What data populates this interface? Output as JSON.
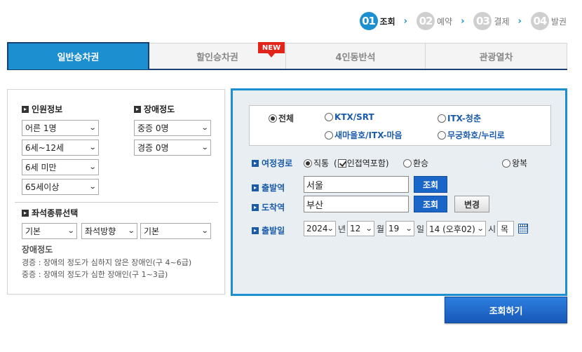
{
  "steps": [
    {
      "num": "01",
      "label": "조회",
      "active": true
    },
    {
      "num": "02",
      "label": "예약",
      "active": false
    },
    {
      "num": "03",
      "label": "결제",
      "active": false
    },
    {
      "num": "04",
      "label": "발권",
      "active": false
    }
  ],
  "tabs": [
    {
      "label": "일반승차권",
      "active": true
    },
    {
      "label": "할인승차권",
      "active": false,
      "badge": "NEW"
    },
    {
      "label": "4인동반석",
      "active": false
    },
    {
      "label": "관광열차",
      "active": false
    }
  ],
  "passengers": {
    "title": "인원정보",
    "selects": [
      "어른 1명",
      "6세~12세",
      "6세 미만",
      "65세이상"
    ]
  },
  "disability": {
    "title": "장애정도",
    "selects": [
      "중증 0명",
      "경증 0명"
    ]
  },
  "seat": {
    "title": "좌석종류선택",
    "selects": [
      "기본",
      "좌석방향",
      "기본"
    ]
  },
  "notes": {
    "title": "장애정도",
    "lines": [
      "경증 : 장애의 정도가 심하지 않은 장애인(구 4~6급)",
      "중증 : 장애의 정도가 심한 장애인(구 1~3급)"
    ]
  },
  "train_types": [
    {
      "label": "전체",
      "checked": true
    },
    {
      "label": "KTX/SRT",
      "checked": false
    },
    {
      "label": "ITX-청춘",
      "checked": false
    },
    {
      "label": "새마을호/ITX-마음",
      "checked": false
    },
    {
      "label": "무궁화호/누리로",
      "checked": false
    }
  ],
  "route": {
    "label": "여정경로",
    "direct": "직통",
    "nearby_open": "(",
    "nearby": "인접역포함)",
    "transfer": "환승",
    "roundtrip": "왕복"
  },
  "departure": {
    "label": "출발역",
    "value": "서울",
    "search_btn": "조회"
  },
  "arrival": {
    "label": "도착역",
    "value": "부산",
    "search_btn": "조회",
    "change_btn": "변경"
  },
  "date": {
    "label": "출발일",
    "year": "2024",
    "year_unit": "년",
    "month": "12",
    "month_unit": "월",
    "day": "19",
    "day_unit": "일",
    "hour": "14 (오후02)",
    "hour_unit": "시",
    "weekday": "목"
  },
  "search_button": "조회하기",
  "colors": {
    "accent": "#1b8fd0",
    "navy": "#1a3f73",
    "label_blue": "#1a5ba8",
    "badge_red": "#e2231a"
  }
}
